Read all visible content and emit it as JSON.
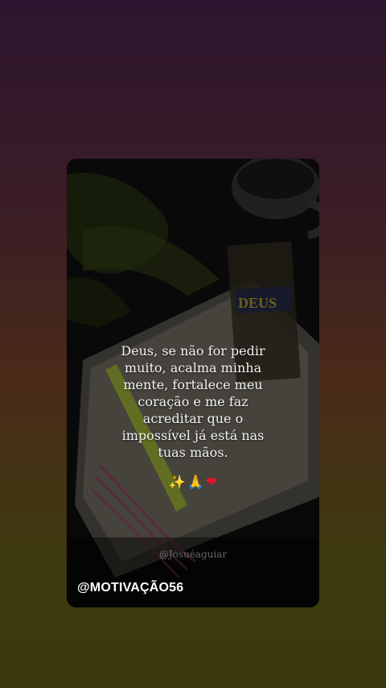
{
  "post": {
    "quote": "Deus, se não for pedir muito, acalma minha mente, fortalece meu coração e me faz acreditar que o impossível já está nas tuas mãos.",
    "emojis": [
      "✨",
      "🙏",
      "❤"
    ],
    "signature": "@Josuéaguiar",
    "handle": "@MOTIVAÇÃO56",
    "book_word": "DEUS"
  },
  "colors": {
    "highlighter": "#b8d43a",
    "heart": "#e0152b",
    "text": "#f2f2f2"
  }
}
